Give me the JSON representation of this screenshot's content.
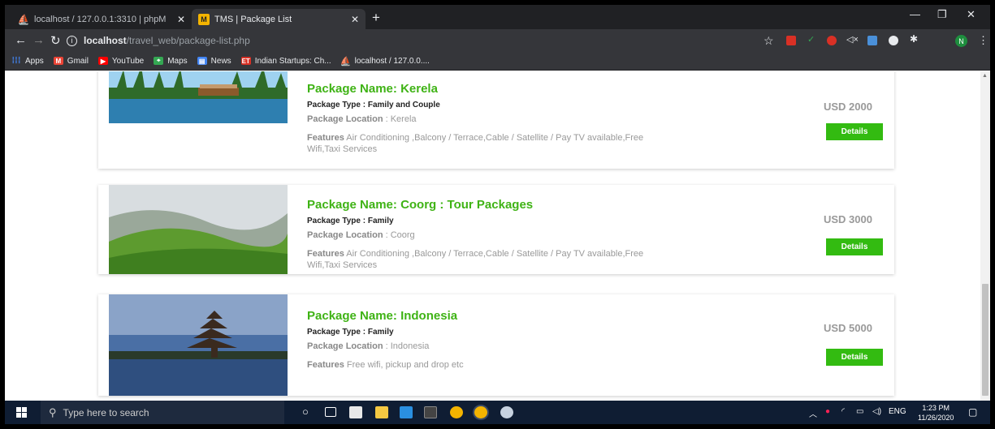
{
  "browser": {
    "tabs": [
      {
        "title": "localhost / 127.0.0.1:3310 | phpM",
        "active": false
      },
      {
        "title": "TMS | Package List",
        "active": true
      }
    ],
    "new_tab": "+",
    "url_host": "localhost",
    "url_path": "/travel_web/package-list.php",
    "avatar_letter": "N",
    "bookmarks": [
      {
        "label": "Apps",
        "icon": "apps-grid-icon"
      },
      {
        "label": "Gmail",
        "icon": "gmail-icon"
      },
      {
        "label": "YouTube",
        "icon": "youtube-icon"
      },
      {
        "label": "Maps",
        "icon": "maps-icon"
      },
      {
        "label": "News",
        "icon": "news-icon"
      },
      {
        "label": "Indian Startups: Ch...",
        "icon": "et-icon"
      },
      {
        "label": "localhost / 127.0.0....",
        "icon": "phpmyadmin-icon"
      }
    ]
  },
  "packages": [
    {
      "name": "Package Name: Kerela",
      "type": "Package Type : Family and Couple",
      "location_label": "Package Location",
      "location": " : Kerela",
      "features_label": "Features",
      "features": " Air Conditioning ,Balcony / Terrace,Cable / Satellite / Pay TV available,Free Wifi,Taxi Services",
      "price": "USD 2000",
      "button": "Details"
    },
    {
      "name": "Package Name: Coorg : Tour Packages",
      "type": "Package Type : Family",
      "location_label": "Package Location",
      "location": " : Coorg",
      "features_label": "Features",
      "features": " Air Conditioning ,Balcony / Terrace,Cable / Satellite / Pay TV available,Free Wifi,Taxi Services",
      "price": "USD 3000",
      "button": "Details"
    },
    {
      "name": "Package Name: Indonesia",
      "type": "Package Type : Family",
      "location_label": "Package Location",
      "location": " : Indonesia",
      "features_label": "Features",
      "features": " Free wifi, pickup and drop etc",
      "price": "USD 5000",
      "button": "Details"
    }
  ],
  "taskbar": {
    "search_placeholder": "Type here to search",
    "lang": "ENG",
    "time": "1:23 PM",
    "date": "11/26/2020"
  },
  "colors": {
    "accent_green": "#3fb315",
    "button_green": "#33bb11"
  }
}
